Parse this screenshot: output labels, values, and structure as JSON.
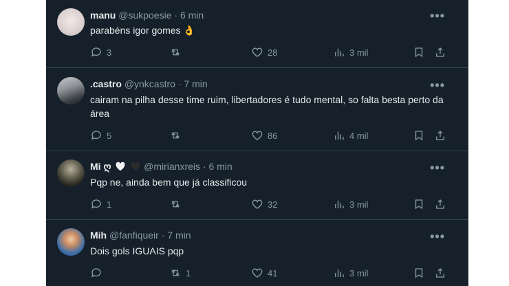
{
  "tweets": [
    {
      "name": "manu",
      "handle": "@sukpoesie",
      "time": "6 min",
      "text": "parabéns igor gomes 👌",
      "replies": "3",
      "retweets": "",
      "likes": "28",
      "views": "3 mil"
    },
    {
      "name": ".castro",
      "handle": "@ynkcastro",
      "time": "7 min",
      "text": "cairam na pilha desse time ruim, libertadores é tudo mental, so falta besta perto da área",
      "replies": "5",
      "retweets": "",
      "likes": "86",
      "views": "4 mil"
    },
    {
      "name": "Mi ღ",
      "handle": "@mirianxreis",
      "time": "6 min",
      "text": "Pqp ne, ainda bem que já classificou",
      "replies": "1",
      "retweets": "",
      "likes": "32",
      "views": "3 mil"
    },
    {
      "name": "Mih",
      "handle": "@fanfiqueir",
      "time": "7 min",
      "text": "Dois gols IGUAIS pqp",
      "replies": "",
      "retweets": "1",
      "likes": "41",
      "views": "3 mil"
    }
  ],
  "ui": {
    "separator": "·",
    "more_glyph": "•••"
  },
  "colors": {
    "background": "#15202b",
    "text_primary": "#e7e9ea",
    "text_secondary": "#8b98a5",
    "divider": "#38444d"
  },
  "icons": {
    "reply": "reply-icon",
    "retweet": "retweet-icon",
    "like": "heart-icon",
    "views": "views-icon",
    "bookmark": "bookmark-icon",
    "share": "share-icon",
    "more": "more-icon"
  }
}
